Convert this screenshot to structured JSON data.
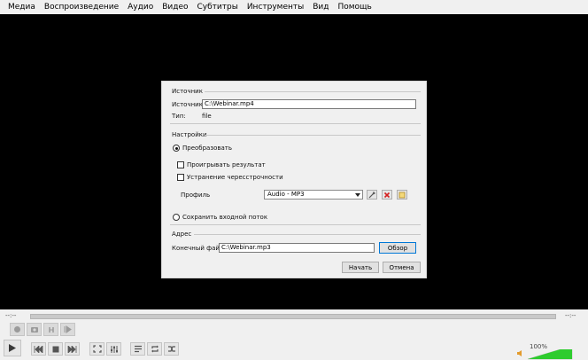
{
  "menu": [
    "Медиа",
    "Воспроизведение",
    "Аудио",
    "Видео",
    "Субтитры",
    "Инструменты",
    "Вид",
    "Помощь"
  ],
  "dialog": {
    "source_section": "Источник",
    "source_label": "Источник:",
    "source_value": "C:\\Webinar.mp4",
    "type_label": "Тип:",
    "type_value": "file",
    "settings_section": "Настройки",
    "convert_label": "Преобразовать",
    "play_result_label": "Проигрывать результат",
    "deinterlace_label": "Устранение чересстрочности",
    "profile_label": "Профиль",
    "profile_value": "Audio - MP3",
    "dump_label": "Сохранить входной поток",
    "destination_section": "Адрес",
    "dest_file_label": "Конечный файл:",
    "dest_file_value": "C:\\Webinar.mp3",
    "browse_label": "Обзор",
    "start_label": "Начать",
    "cancel_label": "Отмена",
    "convert_selected": true,
    "play_result_checked": false,
    "deinterlace_checked": false,
    "dump_selected": false
  },
  "player": {
    "time_elapsed": "--:--",
    "time_total": "--:--",
    "volume_label": "100%",
    "volume_level": 1.0,
    "volume_color": "#2ecc2e"
  },
  "icons": [
    "record-icon",
    "snapshot-icon",
    "loop-ab-icon",
    "frame-step-icon",
    "play-icon",
    "previous-icon",
    "stop-icon",
    "next-icon",
    "fullscreen-icon",
    "extended-settings-icon",
    "playlist-icon",
    "loop-icon",
    "shuffle-icon",
    "speaker-icon",
    "wrench-icon",
    "delete-icon",
    "new-profile-icon"
  ]
}
